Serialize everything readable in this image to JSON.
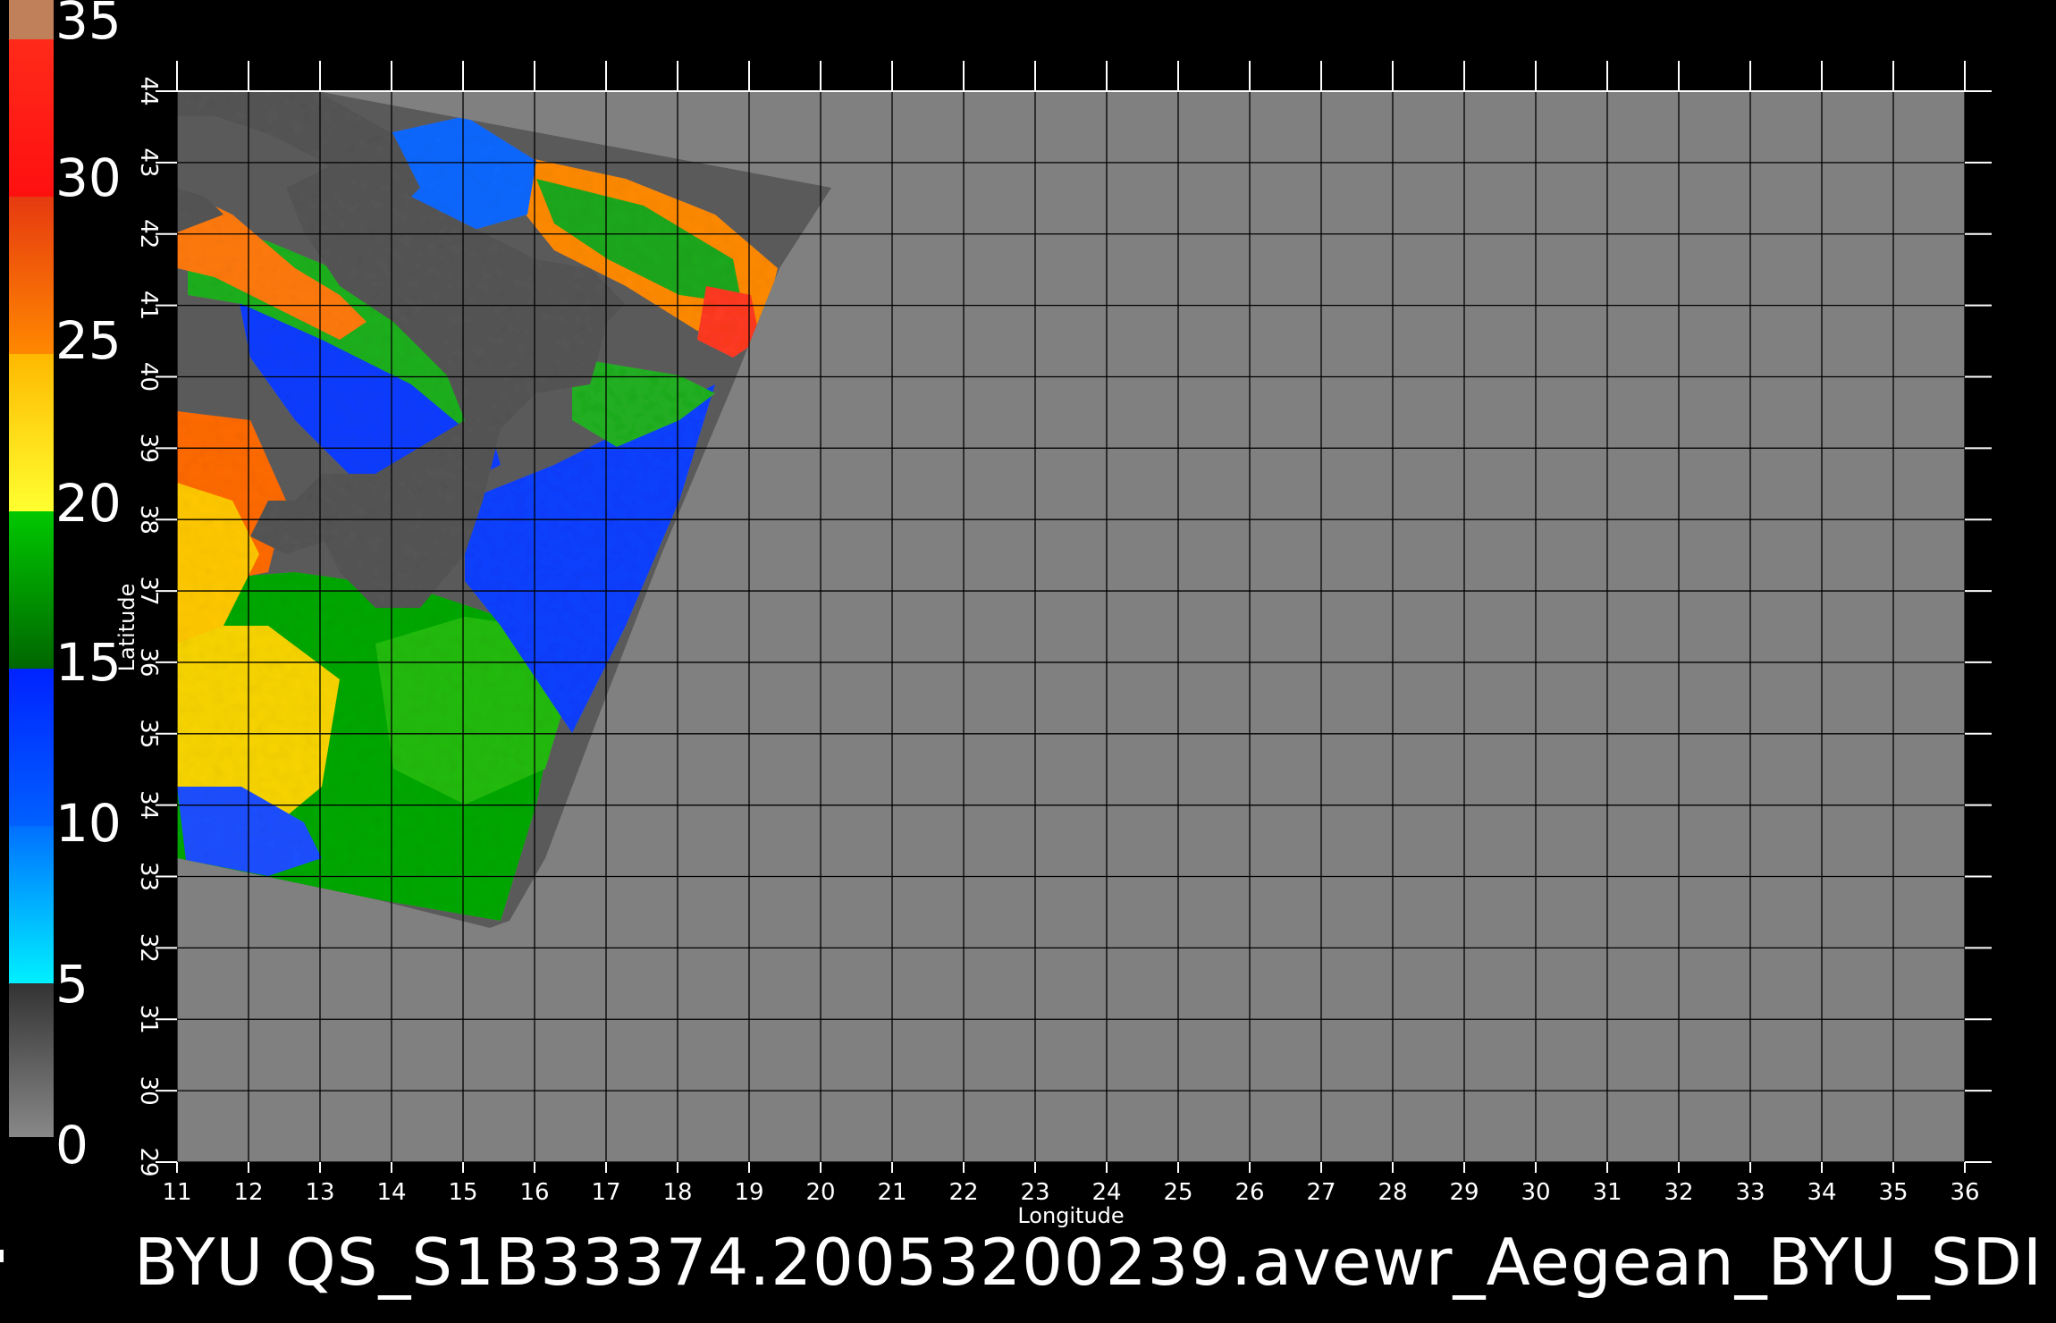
{
  "colorbar": {
    "labels": [
      "35",
      "30",
      "25",
      "20",
      "15",
      "10",
      "5",
      "0"
    ],
    "colors": {
      "0_5": "#555555",
      "5_10": "#00c8ff",
      "10_15": "#0044ff",
      "15_20": "#009900",
      "20_25": "#ffd800",
      "25_30": "#ff5a00",
      "30_35": "#ff1a1a",
      "35_top": "#c0805a"
    }
  },
  "axes": {
    "x_ticks": [
      "11",
      "12",
      "13",
      "14",
      "15",
      "16",
      "17",
      "18",
      "19",
      "20",
      "21",
      "22",
      "23",
      "24",
      "25",
      "26",
      "27",
      "28",
      "29",
      "30",
      "31",
      "32",
      "33",
      "34",
      "35",
      "36"
    ],
    "y_ticks": [
      "29",
      "30",
      "31",
      "32",
      "33",
      "34",
      "35",
      "36",
      "37",
      "38",
      "39",
      "40",
      "41",
      "42",
      "43",
      "44"
    ],
    "xlabel": "Longitude",
    "ylabel": "Latitude",
    "xlim": [
      11,
      36
    ],
    "ylim": [
      29,
      44
    ]
  },
  "colors": {
    "background": "#000000",
    "nodata": "#808080",
    "land": "#555555",
    "grid": "#000000"
  },
  "title": "BYU  QS_S1B33374.20053200239.avewr_Aegean_BYU_SDI"
}
